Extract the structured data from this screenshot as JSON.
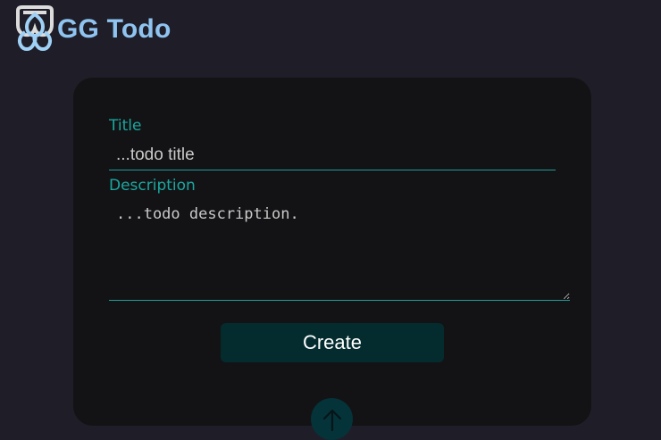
{
  "header": {
    "brand_name": "GG Todo",
    "logo_icon": "gg-knot-logo",
    "brand_color": "#8fc3f0"
  },
  "form": {
    "title_label": "Title",
    "title_placeholder": "...todo title",
    "description_label": "Description",
    "description_placeholder": "...todo description.",
    "create_label": "Create",
    "accent_color": "#1aa7a0",
    "button_color": "#042c2f"
  },
  "scroll_top": {
    "icon": "arrow-up-icon"
  }
}
